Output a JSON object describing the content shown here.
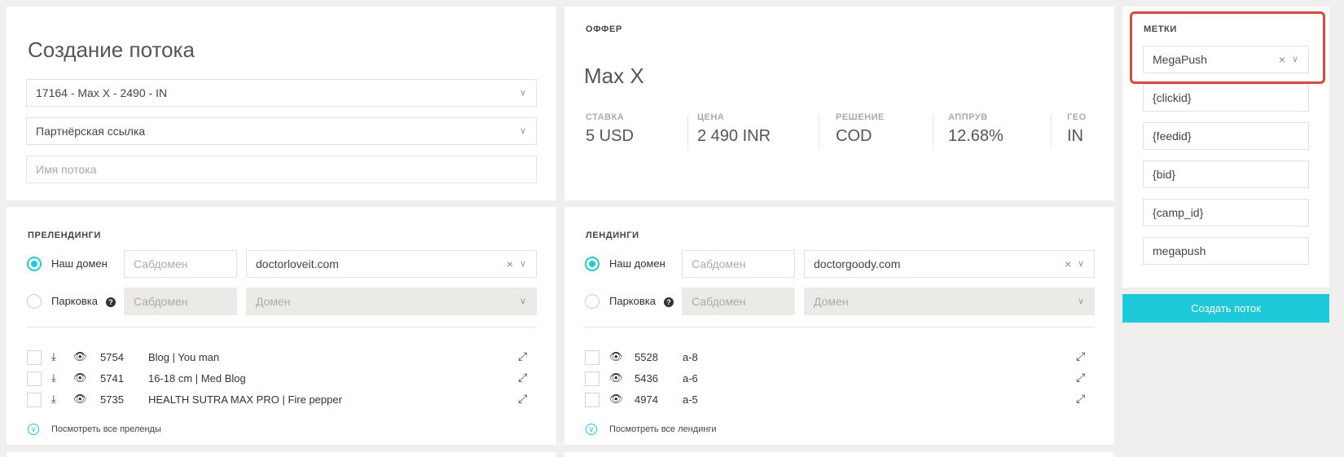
{
  "stream": {
    "title": "Создание потока",
    "offer_select": "17164 - Max X - 2490 - IN",
    "link_type_select": "Партнёрская ссылка",
    "name_placeholder": "Имя потока"
  },
  "offer": {
    "section_title": "ОФФЕР",
    "name": "Max X",
    "stats": [
      {
        "label": "СТАВКА",
        "value": "5 USD"
      },
      {
        "label": "ЦЕНА",
        "value": "2 490 INR"
      },
      {
        "label": "РЕШЕНИЕ",
        "value": "COD"
      },
      {
        "label": "АППРУВ",
        "value": "12.68%"
      },
      {
        "label": "ГЕО",
        "value": "IN"
      }
    ]
  },
  "tags": {
    "section_title": "МЕТКИ",
    "selected": "MegaPush",
    "fields": [
      "{clickid}",
      "{feedid}",
      "{bid}",
      "{camp_id}",
      "megapush"
    ],
    "create_button": "Создать поток"
  },
  "prelandings": {
    "section_title": "ПРЕЛЕНДИНГИ",
    "own_domain_label": "Наш домен",
    "subdomain_placeholder": "Сабдомен",
    "domain_value": "doctorloveit.com",
    "parking_label": "Парковка",
    "parking_subdomain_placeholder": "Сабдомен",
    "parking_domain_placeholder": "Домен",
    "items": [
      {
        "id": "5754",
        "name": "Blog | You man"
      },
      {
        "id": "5741",
        "name": "16-18 cm | Med Blog"
      },
      {
        "id": "5735",
        "name": "HEALTH SUTRA MAX PRO | Fire pepper"
      }
    ],
    "view_all": "Посмотреть все преленды"
  },
  "landings": {
    "section_title": "ЛЕНДИНГИ",
    "own_domain_label": "Наш домен",
    "subdomain_placeholder": "Сабдомен",
    "domain_value": "doctorgoody.com",
    "parking_label": "Парковка",
    "parking_subdomain_placeholder": "Сабдомен",
    "parking_domain_placeholder": "Домен",
    "items": [
      {
        "id": "5528",
        "name": "a-8"
      },
      {
        "id": "5436",
        "name": "a-6"
      },
      {
        "id": "4974",
        "name": "a-5"
      }
    ],
    "view_all": "Посмотреть все лендинги"
  },
  "icons": {
    "chevron": "chevron-down-icon",
    "clear": "close-icon",
    "download": "download-icon",
    "eye": "eye-icon",
    "expand": "expand-icon",
    "help": "help-icon",
    "more": "chevron-down-circle-icon"
  },
  "colors": {
    "accent": "#1ec9d9",
    "highlight": "#d94a3e",
    "background": "#f0efed"
  }
}
